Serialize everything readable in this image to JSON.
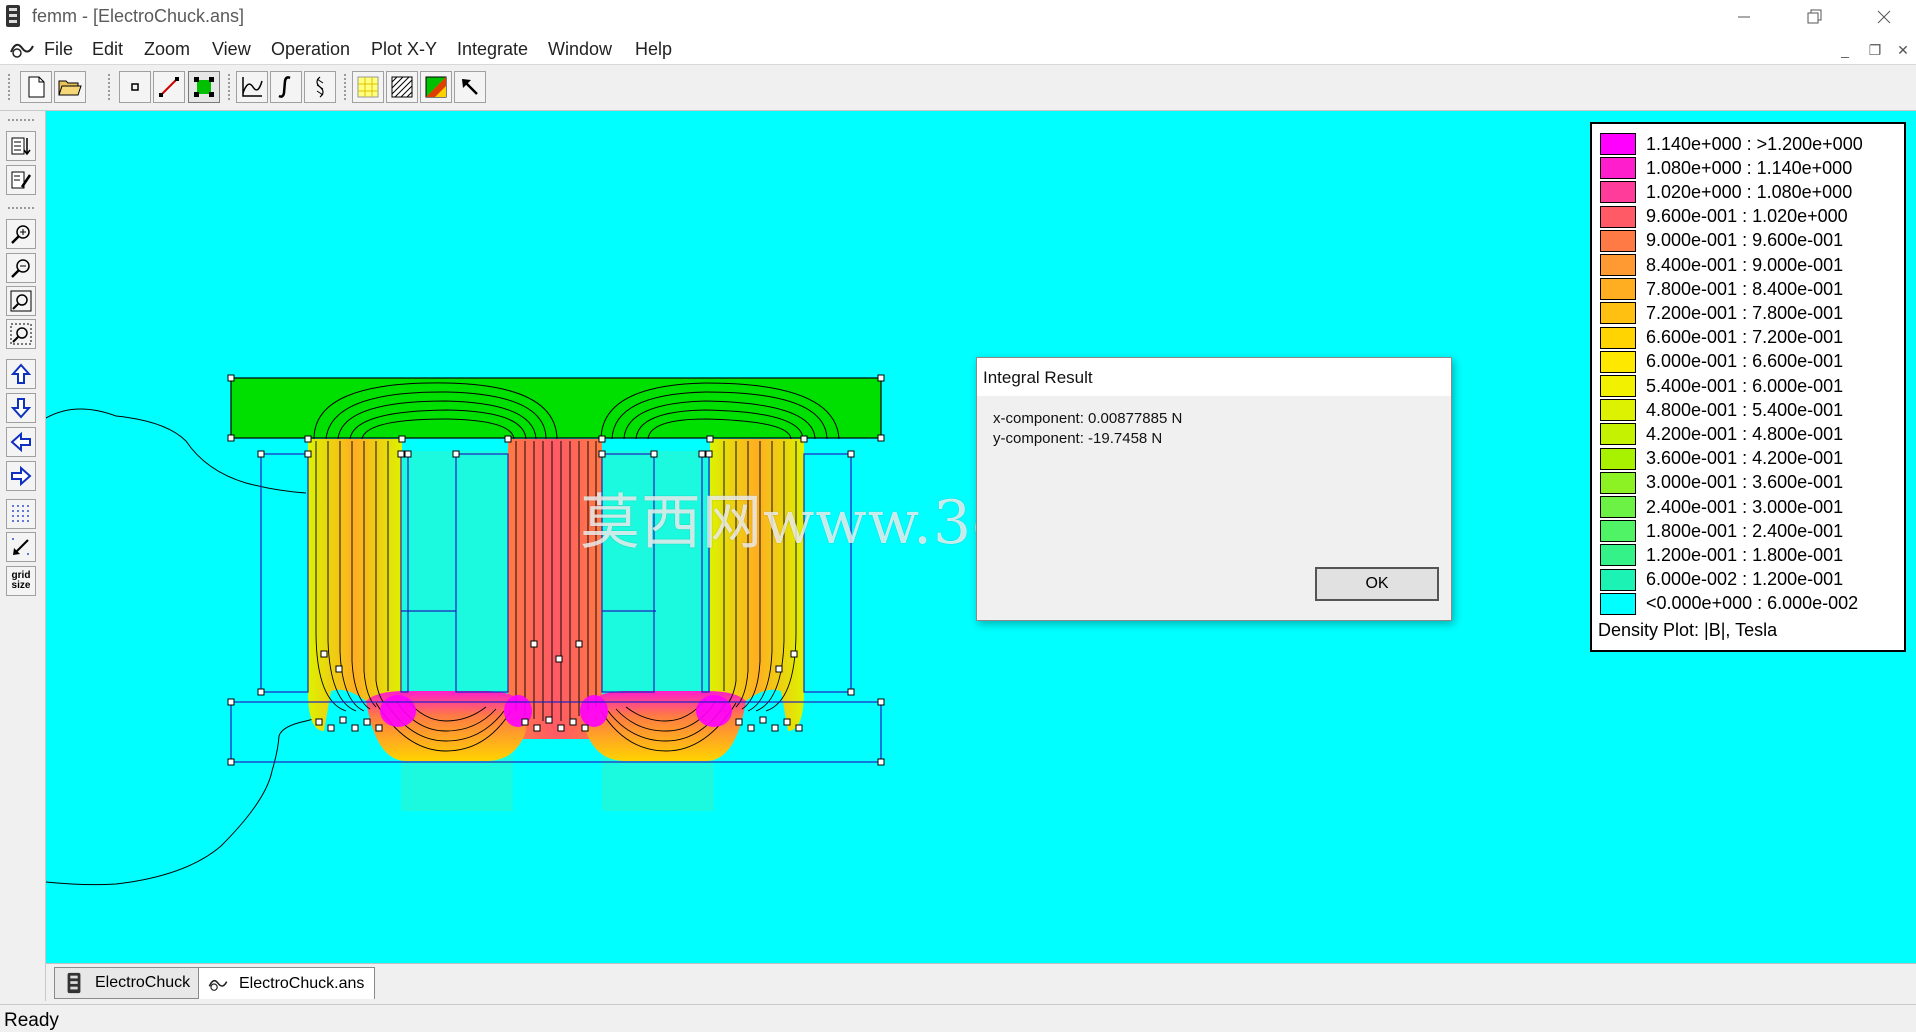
{
  "window": {
    "title": "femm - [ElectroChuck.ans]"
  },
  "menu": [
    "File",
    "Edit",
    "Zoom",
    "View",
    "Operation",
    "Plot X-Y",
    "Integrate",
    "Window",
    "Help"
  ],
  "toolbar": {
    "icons": [
      "new-file-icon",
      "open-file-icon",
      "point-mode-icon",
      "line-mode-icon",
      "area-mode-icon",
      "plot-xy-icon",
      "integrate-icon",
      "contour-icon",
      "density-plot-icon",
      "hatch-plot-icon",
      "vector-plot-icon",
      "pointer-icon"
    ],
    "active": [
      "area-mode-icon"
    ]
  },
  "left_toolbar": {
    "icons": [
      "show-mesh-icon",
      "edit-props-icon",
      "zoom-in-icon",
      "zoom-out-icon",
      "zoom-natural-icon",
      "zoom-window-icon",
      "pan-up-icon",
      "pan-down-icon",
      "pan-left-icon",
      "pan-right-icon",
      "show-grid-icon",
      "snap-grid-icon",
      "grid-size-icon"
    ],
    "grid_size_label_1": "grid",
    "grid_size_label_2": "size"
  },
  "legend": {
    "title": "Density Plot: |B|, Tesla",
    "rows": [
      {
        "label": "1.140e+000 : >1.200e+000",
        "color": "#ff00ff"
      },
      {
        "label": "1.080e+000 : 1.140e+000",
        "color": "#ff1ecc"
      },
      {
        "label": "1.020e+000 : 1.080e+000",
        "color": "#ff3c99"
      },
      {
        "label": "9.600e-001 : 1.020e+000",
        "color": "#ff5a66"
      },
      {
        "label": "9.000e-001 : 9.600e-001",
        "color": "#ff7a44"
      },
      {
        "label": "8.400e-001 : 9.000e-001",
        "color": "#ff9a33"
      },
      {
        "label": "7.800e-001 : 8.400e-001",
        "color": "#ffae22"
      },
      {
        "label": "7.200e-001 : 7.800e-001",
        "color": "#ffc011"
      },
      {
        "label": "6.600e-001 : 7.200e-001",
        "color": "#ffd400"
      },
      {
        "label": "6.000e-001 : 6.600e-001",
        "color": "#ffe800"
      },
      {
        "label": "5.400e-001 : 6.000e-001",
        "color": "#f2f200"
      },
      {
        "label": "4.800e-001 : 5.400e-001",
        "color": "#dcf200"
      },
      {
        "label": "4.200e-001 : 4.800e-001",
        "color": "#c4f200"
      },
      {
        "label": "3.600e-001 : 4.200e-001",
        "color": "#a8f200"
      },
      {
        "label": "3.000e-001 : 3.600e-001",
        "color": "#8cf224"
      },
      {
        "label": "2.400e-001 : 3.000e-001",
        "color": "#6cf244"
      },
      {
        "label": "1.800e-001 : 2.400e-001",
        "color": "#50f266"
      },
      {
        "label": "1.200e-001 : 1.800e-001",
        "color": "#34f288"
      },
      {
        "label": "6.000e-002 : 1.200e-001",
        "color": "#1cf2b4"
      },
      {
        "label": "<0.000e+000 : 6.000e-002",
        "color": "#00ffff"
      }
    ]
  },
  "dialog": {
    "title": "Integral Result",
    "x_component": "x-component: 0.00877885 N",
    "y_component": "y-component: -19.7458 N",
    "ok_label": "OK"
  },
  "watermark": "莫西网www.3dmox.com",
  "tabs": [
    {
      "label": "ElectroChuck",
      "icon": "femm-document-icon"
    },
    {
      "label": "ElectroChuck.ans",
      "icon": "femm-view-icon",
      "active": true
    }
  ],
  "status": "Ready"
}
